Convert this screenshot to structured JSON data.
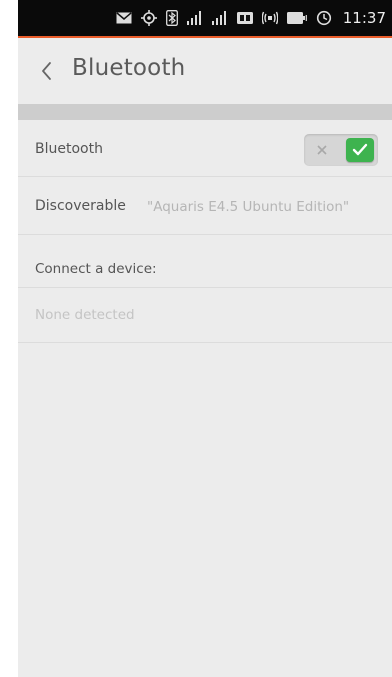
{
  "status_bar": {
    "time": "11:37",
    "icons": [
      "message-icon",
      "location-icon",
      "bluetooth-icon",
      "signal-icon",
      "signal-icon",
      "3g-icon",
      "volume-icon",
      "battery-icon",
      "alarm-icon"
    ],
    "accent_color": "#ea5d2b"
  },
  "header": {
    "title": "Bluetooth"
  },
  "settings": {
    "bluetooth_label": "Bluetooth",
    "bluetooth_enabled": true,
    "discoverable_label": "Discoverable",
    "device_name": "\"Aquaris E4.5 Ubuntu Edition\"",
    "connect_label": "Connect a device:",
    "none_detected": "None detected"
  },
  "colors": {
    "toggle_on": "#3eb34f",
    "background": "#ececec"
  }
}
